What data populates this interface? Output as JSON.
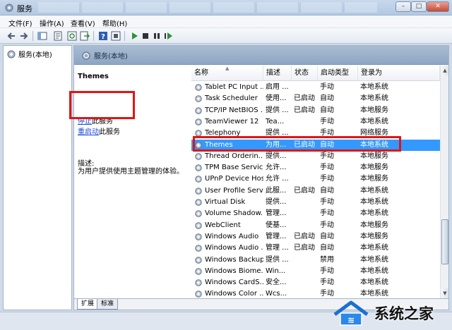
{
  "window": {
    "title": "服务"
  },
  "menu": [
    "文件(F)",
    "操作(A)",
    "查看(V)",
    "帮助(H)"
  ],
  "toolbar_icons": [
    "back-arrow-icon",
    "forward-arrow-icon",
    "console-tree-icon",
    "properties-icon",
    "refresh-icon",
    "export-icon",
    "help-icon",
    "details-icon",
    "play-icon",
    "stop-icon",
    "pause-icon",
    "restart-icon"
  ],
  "tree": {
    "root_label": "服务(本地)"
  },
  "main_header": {
    "title": "服务(本地)"
  },
  "details": {
    "service_name": "Themes",
    "stop_link": "停止",
    "stop_suffix": "此服务",
    "restart_link": "重启动",
    "restart_suffix": "此服务",
    "desc_label": "描述:",
    "desc_text": "为用户提供使用主题管理的体验。"
  },
  "columns": [
    "名称",
    "描述",
    "状态",
    "启动类型",
    "登录为"
  ],
  "rows": [
    {
      "name": "Tablet PC Input ...",
      "desc": "启用 ...",
      "status": "",
      "startup": "手动",
      "logon": "本地系统"
    },
    {
      "name": "Task Scheduler",
      "desc": "使用...",
      "status": "已启动",
      "startup": "自动",
      "logon": "本地系统"
    },
    {
      "name": "TCP/IP NetBIOS ...",
      "desc": "提供 ...",
      "status": "已启动",
      "startup": "自动",
      "logon": "本地服务"
    },
    {
      "name": "TeamViewer 12",
      "desc": "Tea...",
      "status": "",
      "startup": "手动",
      "logon": "本地系统"
    },
    {
      "name": "Telephony",
      "desc": "提供 ...",
      "status": "",
      "startup": "手动",
      "logon": "网络服务"
    },
    {
      "name": "Themes",
      "desc": "为用...",
      "status": "已启动",
      "startup": "自动",
      "logon": "本地系统",
      "selected": true
    },
    {
      "name": "Thread Orderin...",
      "desc": "提供...",
      "status": "",
      "startup": "手动",
      "logon": "本地服务"
    },
    {
      "name": "TPM Base Servic...",
      "desc": "允许...",
      "status": "",
      "startup": "手动",
      "logon": "本地服务"
    },
    {
      "name": "UPnP Device Host",
      "desc": "允许 ...",
      "status": "",
      "startup": "手动",
      "logon": "本地服务"
    },
    {
      "name": "User Profile Serv...",
      "desc": "此服...",
      "status": "已启动",
      "startup": "自动",
      "logon": "本地系统"
    },
    {
      "name": "Virtual Disk",
      "desc": "提供...",
      "status": "",
      "startup": "手动",
      "logon": "本地系统"
    },
    {
      "name": "Volume Shadow...",
      "desc": "管理...",
      "status": "",
      "startup": "手动",
      "logon": "本地系统"
    },
    {
      "name": "WebClient",
      "desc": "使基...",
      "status": "",
      "startup": "手动",
      "logon": "本地服务"
    },
    {
      "name": "Windows Audio",
      "desc": "管理...",
      "status": "已启动",
      "startup": "自动",
      "logon": "本地服务"
    },
    {
      "name": "Windows Audio ...",
      "desc": "管理 ...",
      "status": "已启动",
      "startup": "自动",
      "logon": "本地系统"
    },
    {
      "name": "Windows Backup",
      "desc": "提供 ...",
      "status": "",
      "startup": "禁用",
      "logon": "本地系统"
    },
    {
      "name": "Windows Biome...",
      "desc": "Win...",
      "status": "",
      "startup": "手动",
      "logon": "本地系统"
    },
    {
      "name": "Windows CardS...",
      "desc": "安全...",
      "status": "",
      "startup": "手动",
      "logon": "本地系统"
    },
    {
      "name": "Windows Color ...",
      "desc": "Wcs...",
      "status": "",
      "startup": "手动",
      "logon": "本地系统"
    }
  ],
  "tabs": [
    "扩展",
    "标准"
  ],
  "watermark": {
    "text": "系统之家"
  },
  "colors": {
    "selection": "#3399ff",
    "highlight_box": "#e01515",
    "link": "#1a4bd8"
  }
}
